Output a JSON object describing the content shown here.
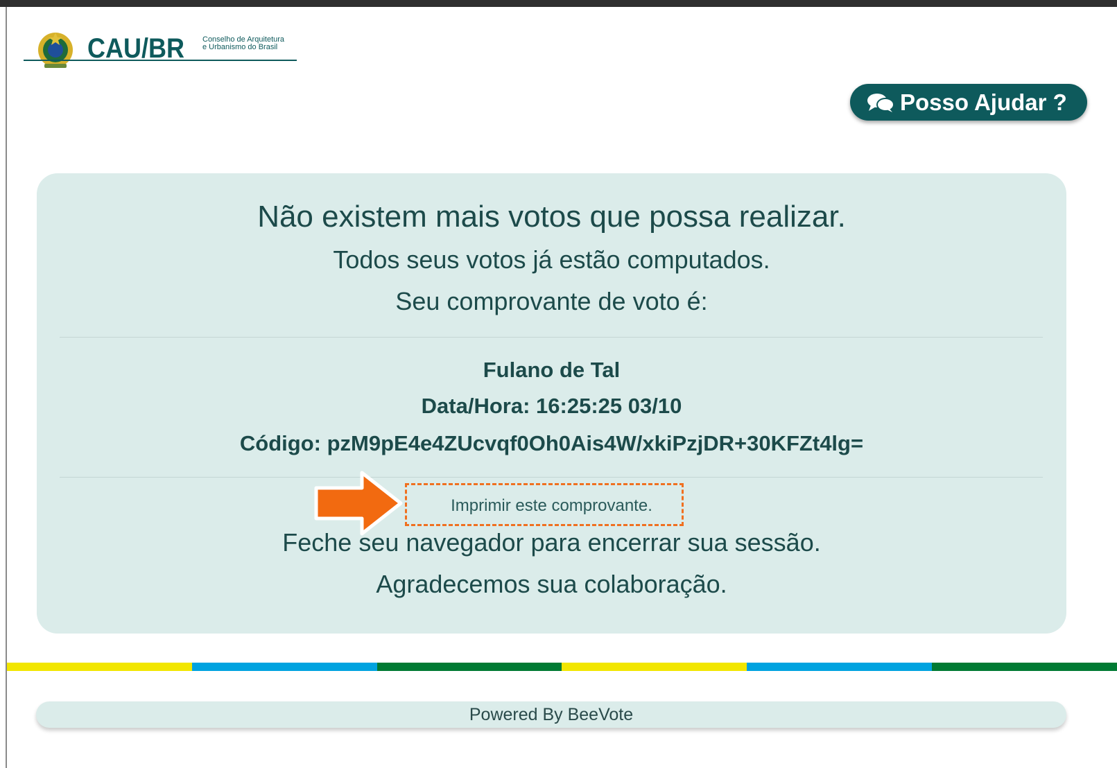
{
  "header": {
    "logo_text": "CAU/BR",
    "logo_subtitle_line1": "Conselho de Arquitetura",
    "logo_subtitle_line2": "e Urbanismo do Brasil"
  },
  "help_button": {
    "label": "Posso Ajudar ?",
    "icon": "chat-bubbles-icon"
  },
  "message": {
    "title": "Não existem mais votos que possa realizar.",
    "subtitle": "Todos seus votos já estão computados.",
    "receipt_intro": "Seu comprovante de voto é:"
  },
  "receipt": {
    "name": "Fulano de Tal",
    "datetime": "Data/Hora: 16:25:25 03/10",
    "code": "Código: pzM9pE4e4ZUcvqf0Oh0Ais4W/xkiPzjDR+30KFZt4lg="
  },
  "print_link": {
    "label": "Imprimir este comprovante."
  },
  "closing": {
    "line1": "Feche seu navegador para encerrar sua sessão.",
    "line2": "Agradecemos sua colaboração."
  },
  "stripe_colors": [
    "#f2e600",
    "#00a3e0",
    "#007a33",
    "#f2e600",
    "#00a3e0",
    "#007a33"
  ],
  "colors": {
    "primary": "#0e5a5c",
    "card_bg": "#dbecea",
    "annotation": "#f07020"
  },
  "footer": {
    "text": "Powered By BeeVote"
  }
}
